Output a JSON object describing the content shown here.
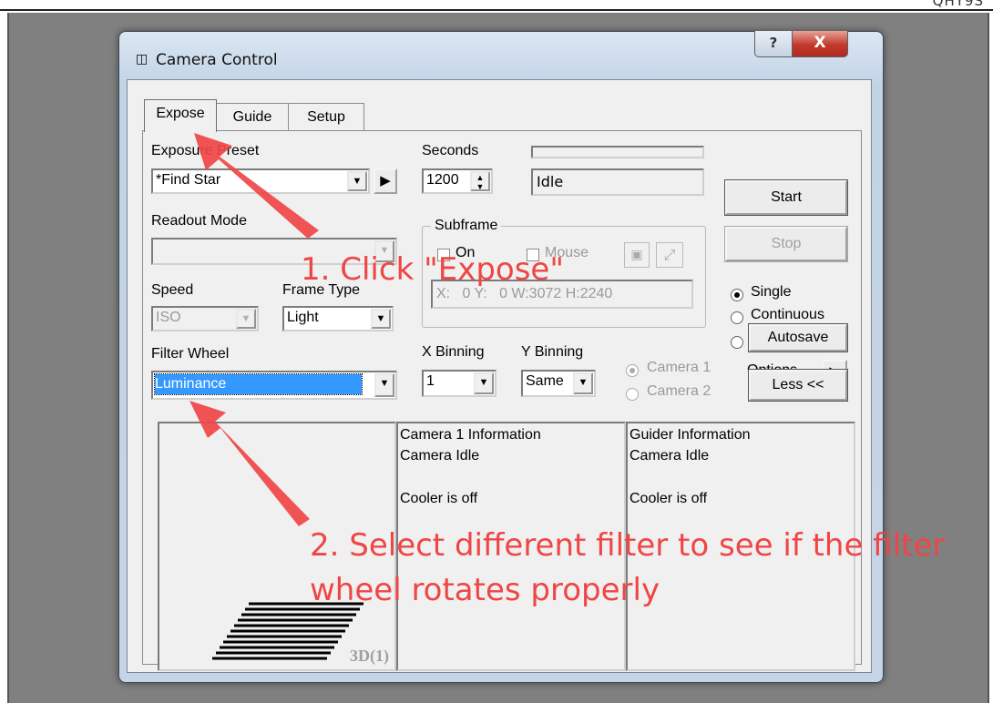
{
  "page_header_fragment": "QHY9S",
  "window": {
    "title": "Camera Control",
    "help_label": "?",
    "close_label": "X"
  },
  "tabs": [
    "Expose",
    "Guide",
    "Setup"
  ],
  "exposure": {
    "preset_label": "Exposure Preset",
    "preset_value": "*Find Star",
    "seconds_label": "Seconds",
    "seconds_value": "1200",
    "status": "Idle",
    "start_label": "Start",
    "stop_label": "Stop"
  },
  "readout": {
    "label": "Readout Mode",
    "value": ""
  },
  "subframe": {
    "label": "Subframe",
    "on_label": "On",
    "mouse_label": "Mouse",
    "coords": "X:   0 Y:   0 W:3072 H:2240"
  },
  "mode": {
    "single": "Single",
    "continuous": "Continuous",
    "autosave": "Autosave",
    "selected": "Single"
  },
  "speed": {
    "label": "Speed",
    "value": "ISO"
  },
  "frame_type": {
    "label": "Frame Type",
    "value": "Light"
  },
  "options_label": "Options",
  "filter_wheel": {
    "label": "Filter Wheel",
    "value": "Luminance"
  },
  "binning": {
    "x_label": "X Binning",
    "x_value": "1",
    "y_label": "Y Binning",
    "y_value": "Same"
  },
  "camera_select": {
    "camera1": "Camera 1",
    "camera2": "Camera 2"
  },
  "less_label": "Less <<",
  "preview_label": "3D(1)",
  "camera_info": {
    "title": "Camera 1 Information",
    "status": "Camera Idle",
    "cooler": "Cooler is off"
  },
  "guider_info": {
    "title": "Guider Information",
    "status": "Camera Idle",
    "cooler": "Cooler is off"
  },
  "annotations": {
    "step1": "1. Click \"Expose\"",
    "step2_line1": "2. Select different filter to see if the filter",
    "step2_line2": "wheel rotates properly"
  },
  "colors": {
    "annotation": "#f04545",
    "selection": "#3399ff"
  }
}
